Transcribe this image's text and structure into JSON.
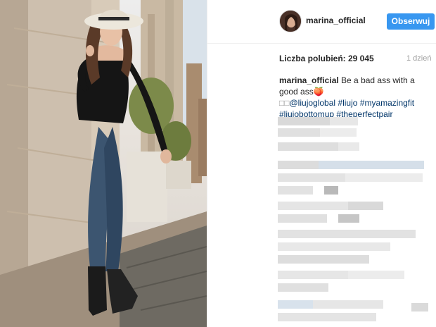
{
  "post": {
    "author": "marina_official",
    "follow_label": "Obserwuj",
    "likes_text": "Liczba polubień: 29 045",
    "time_ago": "1 dzień",
    "caption": {
      "author": "marina_official",
      "text_line1": "Be a bad ass with a",
      "text_line2": "good ass",
      "emoji": "🍑",
      "garbled_prefix": "□□",
      "hashtags": [
        "@liujoglobal",
        "#liujo",
        "#myamazingfit",
        "#liujobottomup",
        "#theperfectpair"
      ]
    }
  },
  "colors": {
    "accent": "#3897f0",
    "link": "#003569",
    "muted": "#a0a0a0"
  },
  "icons": {
    "avatar": "profile-photo",
    "photo": "post-photo"
  }
}
